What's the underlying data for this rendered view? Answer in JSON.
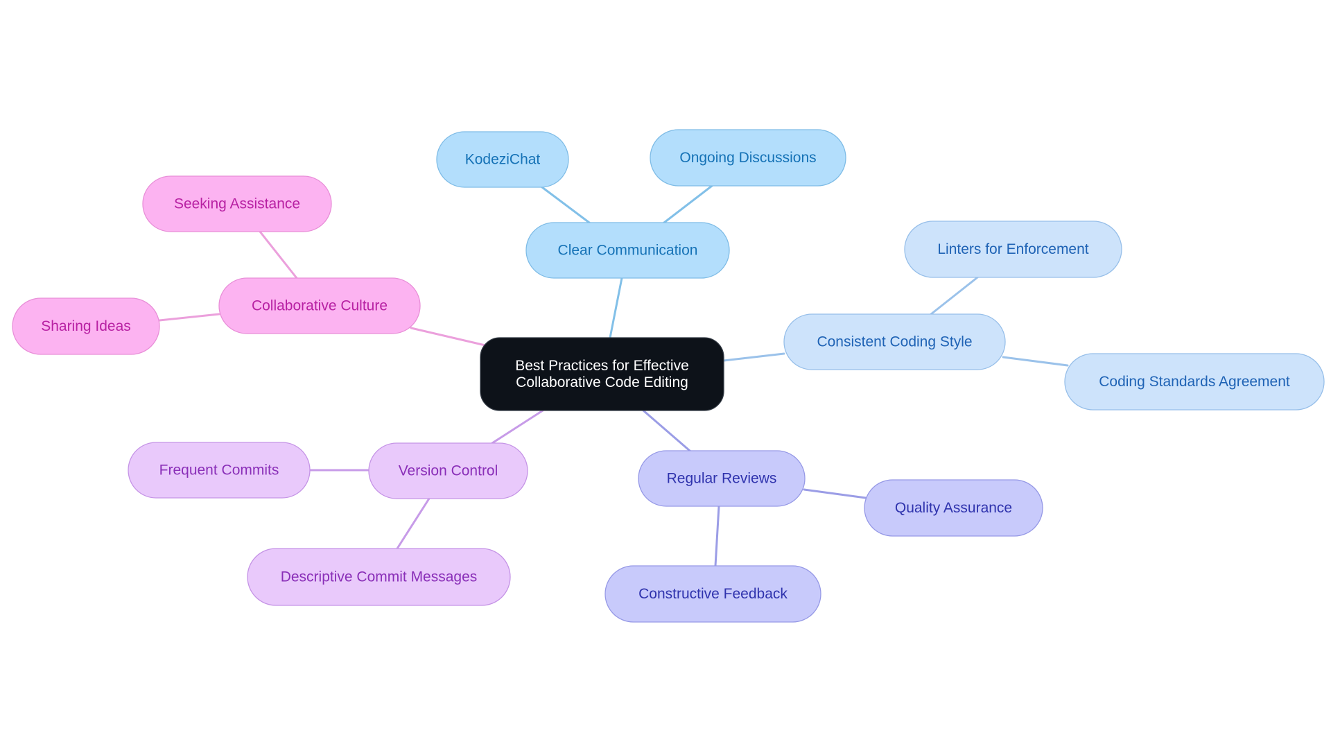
{
  "diagram": {
    "type": "mindmap",
    "root": {
      "id": "root",
      "label_lines": [
        "Best Practices for Effective",
        "Collaborative Code Editing"
      ],
      "fill": "#0d1219",
      "stroke": "#333a44",
      "text_color": "#ffffff"
    },
    "palettes": {
      "sky": {
        "fill": "#b3defc",
        "stroke": "#7fbce6",
        "text": "#1572b6",
        "edge": "#82c0e8"
      },
      "blue": {
        "fill": "#cde3fb",
        "stroke": "#97bfe9",
        "text": "#1f63b5",
        "edge": "#9bc2ea"
      },
      "indigo": {
        "fill": "#c8cafb",
        "stroke": "#9699e6",
        "text": "#2f33ad",
        "edge": "#9b9de6"
      },
      "violet": {
        "fill": "#e9c9fb",
        "stroke": "#c594e6",
        "text": "#8a2fb8",
        "edge": "#c79be8"
      },
      "pink": {
        "fill": "#fcb3f1",
        "stroke": "#e88fd8",
        "text": "#b821a3",
        "edge": "#eba0dc"
      }
    },
    "branches": [
      {
        "id": "clear-communication",
        "label": "Clear Communication",
        "palette": "sky",
        "children": [
          {
            "id": "kodezichat",
            "label": "KodeziChat"
          },
          {
            "id": "ongoing-discussions",
            "label": "Ongoing Discussions"
          }
        ]
      },
      {
        "id": "consistent-coding-style",
        "label": "Consistent Coding Style",
        "palette": "blue",
        "children": [
          {
            "id": "linters-for-enforcement",
            "label": "Linters for Enforcement"
          },
          {
            "id": "coding-standards-agreement",
            "label": "Coding Standards Agreement"
          }
        ]
      },
      {
        "id": "regular-reviews",
        "label": "Regular Reviews",
        "palette": "indigo",
        "children": [
          {
            "id": "quality-assurance",
            "label": "Quality Assurance"
          },
          {
            "id": "constructive-feedback",
            "label": "Constructive Feedback"
          }
        ]
      },
      {
        "id": "version-control",
        "label": "Version Control",
        "palette": "violet",
        "children": [
          {
            "id": "frequent-commits",
            "label": "Frequent Commits"
          },
          {
            "id": "descriptive-commit-messages",
            "label": "Descriptive Commit Messages"
          }
        ]
      },
      {
        "id": "collaborative-culture",
        "label": "Collaborative Culture",
        "palette": "pink",
        "children": [
          {
            "id": "seeking-assistance",
            "label": "Seeking Assistance"
          },
          {
            "id": "sharing-ideas",
            "label": "Sharing Ideas"
          }
        ]
      }
    ]
  }
}
